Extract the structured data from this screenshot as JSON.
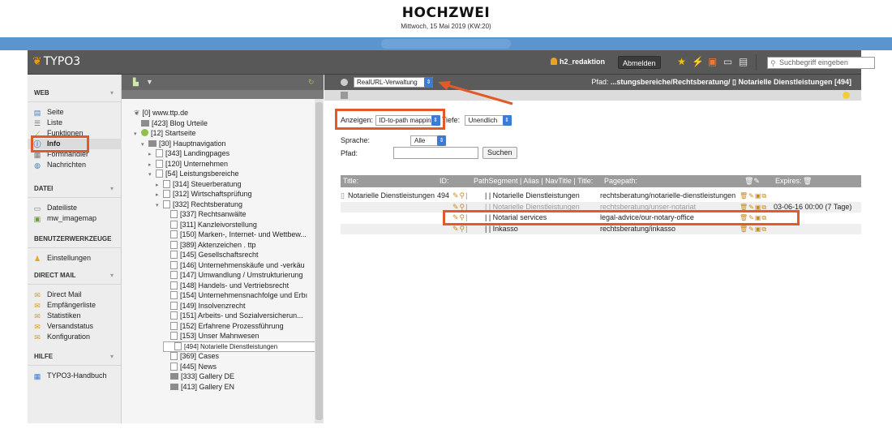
{
  "site": {
    "title": "HOCHZWEI",
    "date": "Mittwoch, 15 Mai 2019 (KW:20)"
  },
  "topbar": {
    "logo": "TYPO3",
    "user": "h2_redaktion",
    "logout": "Abmelden",
    "search_placeholder": "Suchbegriff eingeben"
  },
  "modules": [
    {
      "head": "WEB",
      "items": [
        {
          "label": "Seite",
          "icon": "page-icon"
        },
        {
          "label": "Liste",
          "icon": "list-icon"
        },
        {
          "label": "Funktionen",
          "icon": "wand-icon"
        },
        {
          "label": "Info",
          "icon": "info-icon",
          "active": true
        },
        {
          "label": "Formhandler",
          "icon": "form-icon"
        },
        {
          "label": "Nachrichten",
          "icon": "news-icon"
        }
      ]
    },
    {
      "head": "DATEI",
      "items": [
        {
          "label": "Dateiliste",
          "icon": "folder-icon"
        },
        {
          "label": "mw_imagemap",
          "icon": "image-icon"
        }
      ]
    },
    {
      "head": "BENUTZERWERKZEUGE",
      "items": [
        {
          "label": "Einstellungen",
          "icon": "user-settings-icon"
        }
      ]
    },
    {
      "head": "DIRECT MAIL",
      "items": [
        {
          "label": "Direct Mail",
          "icon": "mail-icon"
        },
        {
          "label": "Empfängerliste",
          "icon": "mail-icon"
        },
        {
          "label": "Statistiken",
          "icon": "mail-icon"
        },
        {
          "label": "Versandstatus",
          "icon": "mail-icon"
        },
        {
          "label": "Konfiguration",
          "icon": "mail-icon"
        }
      ]
    },
    {
      "head": "HILFE",
      "items": [
        {
          "label": "TYPO3-Handbuch",
          "icon": "book-icon"
        }
      ]
    }
  ],
  "tree": [
    {
      "label": "[0] www.ttp.de",
      "type": "root"
    },
    {
      "label": "[423] Blog Urteile",
      "type": "folder"
    },
    {
      "label": "[12] Startseite",
      "type": "globe"
    },
    {
      "label": "[30] Hauptnavigation",
      "type": "folder"
    },
    {
      "label": "[343] Landingpages",
      "type": "page"
    },
    {
      "label": "[120] Unternehmen",
      "type": "page"
    },
    {
      "label": "[54] Leistungsbereiche",
      "type": "page"
    },
    {
      "label": "[314] Steuerberatung",
      "type": "page"
    },
    {
      "label": "[312] Wirtschaftsprüfung",
      "type": "page"
    },
    {
      "label": "[332] Rechtsberatung",
      "type": "page"
    },
    {
      "label": "[337] Rechtsanwälte",
      "type": "page"
    },
    {
      "label": "[311] Kanzleivorstellung",
      "type": "page"
    },
    {
      "label": "[150] Marken-, Internet- und Wettbew...",
      "type": "page"
    },
    {
      "label": "[389] Aktenzeichen . ttp",
      "type": "page"
    },
    {
      "label": "[145] Gesellschaftsrecht",
      "type": "page"
    },
    {
      "label": "[146] Unternehmenskäufe und -verkäu",
      "type": "page"
    },
    {
      "label": "[147] Umwandlung / Umstrukturierung",
      "type": "page"
    },
    {
      "label": "[148] Handels- und Vertriebsrecht",
      "type": "page"
    },
    {
      "label": "[154] Unternehmensnachfolge und Erbı",
      "type": "page"
    },
    {
      "label": "[149] Insolvenzrecht",
      "type": "page"
    },
    {
      "label": "[151] Arbeits- und Sozialversicherun...",
      "type": "page"
    },
    {
      "label": "[152] Erfahrene Prozessführung",
      "type": "page"
    },
    {
      "label": "[153] Unser Mahnwesen",
      "type": "page"
    },
    {
      "label": "[494] Notarielle Dienstleistungen",
      "type": "page",
      "selected": true
    },
    {
      "label": "[369] Cases",
      "type": "page"
    },
    {
      "label": "[445] News",
      "type": "page"
    },
    {
      "label": "[333] Gallery DE",
      "type": "folder"
    },
    {
      "label": "[413] Gallery EN",
      "type": "folder"
    }
  ],
  "content": {
    "function_select": "RealURL-Verwaltung",
    "path_label": "Pfad:",
    "path_value": "...stungsbereiche/Rechtsberatung/",
    "page_title": "Notarielle Dienstleistungen [494]",
    "anzeigen_label": "Anzeigen:",
    "anzeigen_value": "ID-to-path mapping",
    "tiefe_label": "Tiefe:",
    "tiefe_value": "Unendlich",
    "sprache_label": "Sprache:",
    "sprache_value": "Alle",
    "pfad_label": "Pfad:",
    "search_button": "Suchen",
    "columns": {
      "title": "Title:",
      "id": "ID:",
      "segment": "PathSegment | Alias | NavTitle | Title:",
      "pagepath": "Pagepath:",
      "expires": "Expires:"
    },
    "rows": [
      {
        "title": "Notarielle Dienstleistungen",
        "id": "494",
        "segment": "| | Notarielle Dienstleistungen",
        "pagepath": "rechtsberatung/notarielle-dienstleistungen",
        "expires": "",
        "muted": false
      },
      {
        "title": "",
        "id": "",
        "segment": "| | Notarielle Dienstleistungen",
        "pagepath": "rechtsberatung/unser-notariat",
        "expires": "03-06-16 00:00 (7 Tage)",
        "muted": true
      },
      {
        "title": "",
        "id": "",
        "segment": "| | Notarial services",
        "pagepath": "legal-advice/our-notary-office",
        "expires": "",
        "muted": false
      },
      {
        "title": "",
        "id": "",
        "segment": "| | Inkasso",
        "pagepath": "rechtsberatung/inkasso",
        "expires": "",
        "muted": false
      }
    ]
  }
}
